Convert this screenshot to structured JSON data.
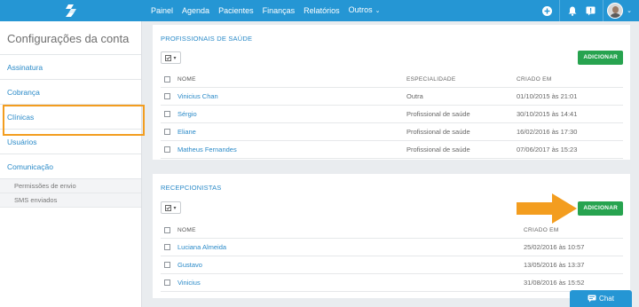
{
  "topbar": {
    "nav": [
      {
        "label": "Painel"
      },
      {
        "label": "Agenda"
      },
      {
        "label": "Pacientes"
      },
      {
        "label": "Finanças"
      },
      {
        "label": "Relatórios"
      },
      {
        "label": "Outros",
        "caret": "⌄"
      }
    ],
    "icons": [
      "plus-circle-icon",
      "bell-icon",
      "help-icon",
      "avatar"
    ],
    "accent_color": "#2596d4"
  },
  "sidebar": {
    "title": "Configurações da conta",
    "items": [
      {
        "label": "Assinatura"
      },
      {
        "label": "Cobrança"
      },
      {
        "label": "Clínicas"
      },
      {
        "label": "Usuários"
      },
      {
        "label": "Comunicação"
      }
    ],
    "subitems": [
      {
        "label": "Permissões de envio"
      },
      {
        "label": "SMS enviados"
      }
    ],
    "highlight_color": "#f39d1f"
  },
  "professionals": {
    "title": "PROFISSIONAIS DE SAÚDE",
    "add_label": "ADICIONAR",
    "columns": [
      "NOME",
      "ESPECIALIDADE",
      "CRIADO EM"
    ],
    "rows": [
      {
        "name": "Vinicius Chan",
        "specialty": "Outra",
        "created": "01/10/2015 às 21:01"
      },
      {
        "name": "Sérgio",
        "specialty": "Profissional de saúde",
        "created": "30/10/2015 às 14:41"
      },
      {
        "name": "Eliane",
        "specialty": "Profissional de saúde",
        "created": "16/02/2016 às 17:30"
      },
      {
        "name": "Matheus Fernandes",
        "specialty": "Profissional de saúde",
        "created": "07/06/2017 às 15:23"
      }
    ]
  },
  "receptionists": {
    "title": "RECEPCIONISTAS",
    "add_label": "ADICIONAR",
    "columns": [
      "NOME",
      "CRIADO EM"
    ],
    "rows": [
      {
        "name": "Luciana Almeida",
        "created": "25/02/2016 às 10:57"
      },
      {
        "name": "Gustavo",
        "created": "13/05/2016 às 13:37"
      },
      {
        "name": "Vinicius",
        "created": "31/08/2016 às 15:52"
      }
    ]
  },
  "chat": {
    "label": "Chat"
  },
  "colors": {
    "success": "#27a34f",
    "link": "#2a8ac8",
    "arrow": "#f39d1f"
  }
}
